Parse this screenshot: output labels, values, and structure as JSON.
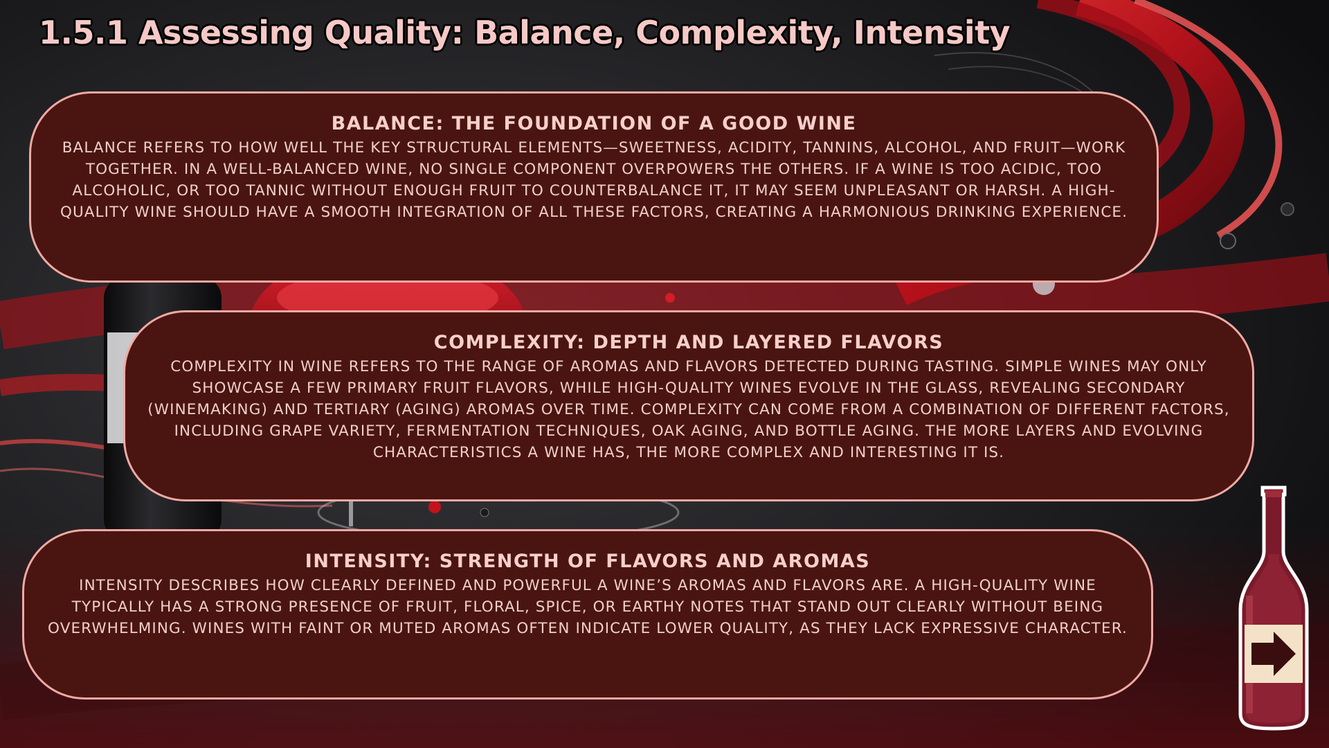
{
  "slide": {
    "title": "1.5.1 Assessing Quality: Balance, Complexity, Intensity"
  },
  "sections": {
    "balance": {
      "heading": "BALANCE: THE FOUNDATION OF A GOOD WINE",
      "body": "Balance refers to how well the key structural elements—sweetness, acidity, tannins, alcohol, and fruit—work together. In a well-balanced wine, no single component overpowers the others. If a wine is too acidic, too alcoholic, or too tannic without enough fruit to counterbalance it, it may seem unpleasant or harsh. A high-quality wine should have a smooth integration of all these factors, creating a harmonious drinking experience."
    },
    "complexity": {
      "heading": "COMPLEXITY: DEPTH AND LAYERED FLAVORS",
      "body": "Complexity in wine refers to the range of aromas and flavors detected during tasting. Simple wines may only showcase a few primary fruit flavors, while high-quality wines evolve in the glass, revealing secondary (winemaking) and tertiary (aging) aromas over time. Complexity can come from a combination of different factors, including grape variety, fermentation techniques, oak aging, and bottle aging. The more layers and evolving characteristics a wine has, the more complex and interesting it is."
    },
    "intensity": {
      "heading": "INTENSITY: STRENGTH OF FLAVORS AND AROMAS",
      "body": "Intensity describes how clearly defined and powerful a wine’s aromas and flavors are. A high-quality wine typically has a strong presence of fruit, floral, spice, or earthy notes that stand out clearly without being overwhelming. Wines with faint or muted aromas often indicate lower quality, as they lack expressive character."
    }
  },
  "navigation": {
    "next_icon": "arrow-right-icon"
  },
  "colors": {
    "card_fill": "#4a1510",
    "card_border": "#f2a9a4",
    "title_text": "#f6c9c6",
    "body_text": "#f0cfcb",
    "accent_red": "#c4121c"
  }
}
